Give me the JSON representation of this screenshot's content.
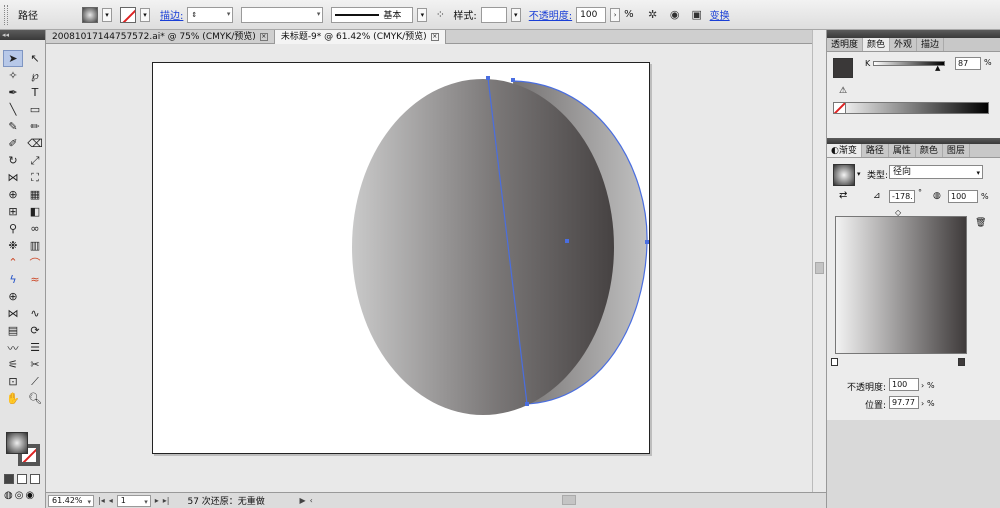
{
  "control_bar": {
    "object_type": "路径",
    "stroke_label": "描边:",
    "stroke_profile": "基本",
    "style_label": "样式:",
    "opacity_label": "不透明度:",
    "opacity_value": "100",
    "opacity_unit": "%",
    "transform_label": "变换"
  },
  "document_tabs": [
    {
      "label": "20081017144757572.ai* @ 75% (CMYK/预览)",
      "active": false
    },
    {
      "label": "未标题-9* @ 61.42% (CMYK/预览)",
      "active": true
    }
  ],
  "status_bar": {
    "zoom": "61.42%",
    "artboard": "1",
    "message": "57 次还原：无重做"
  },
  "color_panel": {
    "tabs": [
      "透明度",
      "颜色",
      "外观",
      "描边"
    ],
    "active_tab": "颜色",
    "channel_label": "K",
    "channel_value": "87",
    "unit": "%",
    "fill_color": "#3a3838"
  },
  "gradient_panel": {
    "tabs": [
      "渐变",
      "路径",
      "属性",
      "颜色",
      "图层"
    ],
    "active_tab": "渐变",
    "type_label": "类型:",
    "type_value": "径向",
    "angle_value": "-178.",
    "angle_unit": "°",
    "aspect_value": "100",
    "aspect_unit": "%",
    "opacity_label": "不透明度:",
    "opacity_value": "100",
    "opacity_unit": "%",
    "location_label": "位置:",
    "location_value": "97.77",
    "location_unit": "%",
    "stop_colors": [
      "#f2f2f2",
      "#3f3b3b"
    ]
  },
  "colors": {
    "selection_path": "#4a6ee0",
    "link": "#1a3fd6"
  }
}
